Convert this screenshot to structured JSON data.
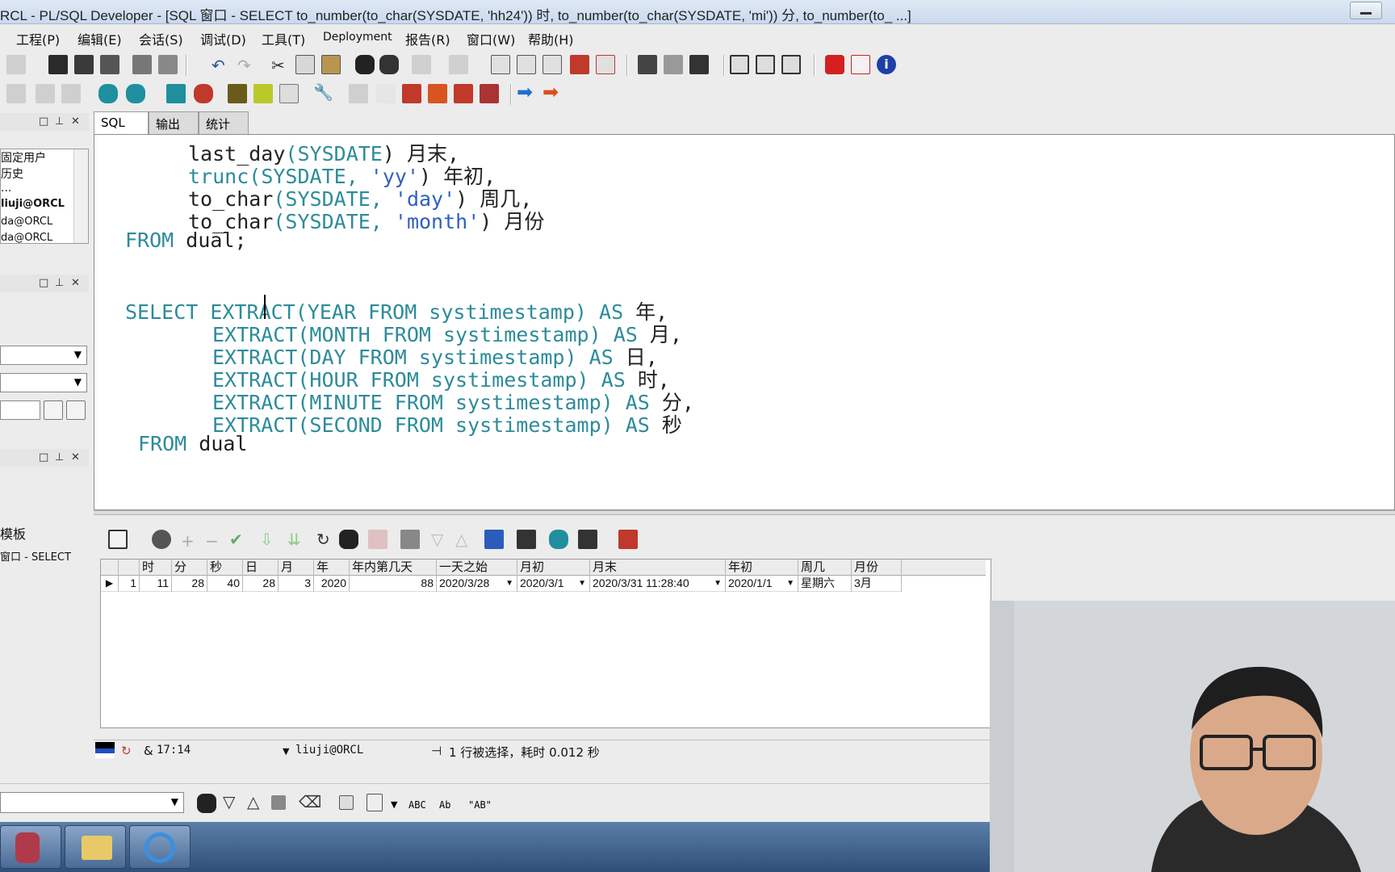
{
  "window": {
    "title": "RCL - PL/SQL Developer - [SQL 窗口 - SELECT to_number(to_char(SYSDATE, 'hh24')) 时, to_number(to_char(SYSDATE, 'mi')) 分, to_number(to_ ...]"
  },
  "menu": [
    {
      "label": "工程(P)"
    },
    {
      "label": "编辑(E)"
    },
    {
      "label": "会话(S)"
    },
    {
      "label": "调试(D)"
    },
    {
      "label": "工具(T)"
    },
    {
      "label": "Deployment"
    },
    {
      "label": "报告(R)"
    },
    {
      "label": "窗口(W)"
    },
    {
      "label": "帮助(H)"
    }
  ],
  "left_panel": {
    "items": [
      {
        "label": "固定用户"
      },
      {
        "label": "历史"
      },
      {
        "label": "..."
      },
      {
        "label": "liuji@ORCL"
      },
      {
        "label": "da@ORCL"
      },
      {
        "label": "da@ORCL"
      }
    ],
    "templates_label": "模板",
    "window_item": "窗口 - SELECT"
  },
  "tabs": [
    {
      "label": "SQL"
    },
    {
      "label": "输出"
    },
    {
      "label": "统计"
    }
  ],
  "editor": {
    "lines": {
      "l1a": "last_day",
      "l1b": "(",
      "l1c": "SYSDATE",
      "l1d": ") 月末,",
      "l2a": "trunc",
      "l2b": "(",
      "l2c": "SYSDATE",
      "l2d": ", ",
      "l2e": "'yy'",
      "l2f": ") 年初,",
      "l3a": "to_char",
      "l3b": "(",
      "l3c": "SYSDATE",
      "l3d": ", ",
      "l3e": "'day'",
      "l3f": ") 周几,",
      "l4a": "to_char",
      "l4b": "(",
      "l4c": "SYSDATE",
      "l4d": ", ",
      "l4e": "'month'",
      "l4f": ") 月份",
      "l5a": "FROM",
      "l5b": " dual;",
      "l6a": "SELECT",
      "l6b": " EXTRACT",
      "l6c": "(YEAR FROM systimestamp) AS",
      "l6d": " 年,",
      "l7a": "EXTRACT",
      "l7b": "(MONTH FROM systimestamp) AS",
      "l7c": " 月,",
      "l8a": "EXTRACT",
      "l8b": "(DAY FROM systimestamp) AS",
      "l8c": " 日,",
      "l9a": "EXTRACT",
      "l9b": "(HOUR FROM systimestamp) AS",
      "l9c": " 时,",
      "l10a": "EXTRACT",
      "l10b": "(MINUTE FROM systimestamp) AS",
      "l10c": " 分,",
      "l11a": "EXTRACT",
      "l11b": "(SECOND FROM systimestamp) AS",
      "l11c": " 秒",
      "l12a": "FROM",
      "l12b": " dual"
    }
  },
  "grid": {
    "headers": [
      "时",
      "分",
      "秒",
      "日",
      "月",
      "年",
      "年内第几天",
      "一天之始",
      "月初",
      "月末",
      "年初",
      "周几",
      "月份"
    ],
    "row": {
      "rownum": "1",
      "cells": [
        "11",
        "28",
        "40",
        "28",
        "3",
        "2020",
        "88",
        "2020/3/28",
        "2020/3/1",
        "2020/3/31 11:28:40",
        "2020/1/1",
        "星期六",
        "3月"
      ]
    }
  },
  "status": {
    "position": "17:14",
    "connection": "liuji@ORCL",
    "message": "1 行被选择，耗时 0.012 秒"
  },
  "findbar": {
    "abc1": "ABC",
    "abc2": "Ab",
    "abc3": "\"AB\""
  }
}
